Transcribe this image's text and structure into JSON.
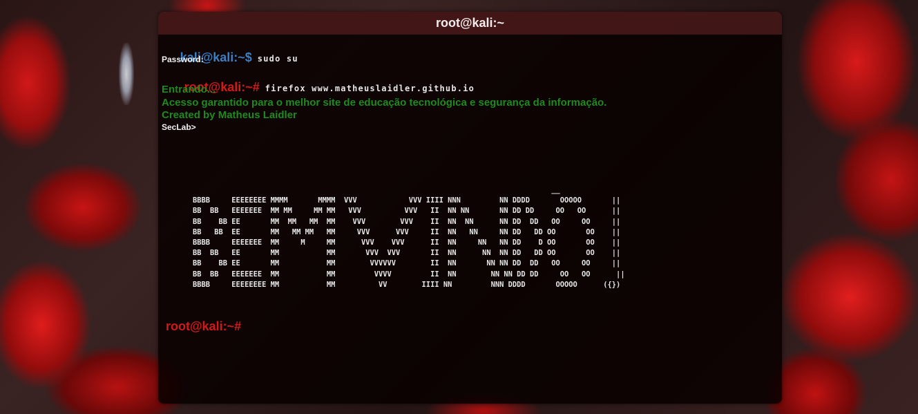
{
  "colors": {
    "user_prompt": "#3b7fc4",
    "root_prompt": "#d11a1a",
    "message": "#1f8a1f",
    "text": "#e6e6e6"
  },
  "window": {
    "title": "root@kali:~"
  },
  "terminal": {
    "line1": {
      "prompt": "kali@kali:~$",
      "command": "sudo su"
    },
    "line2": {
      "text": "Password:"
    },
    "line3": {
      "prompt": "root@kali:~#",
      "command": "firefox www.matheuslaidler.github.io"
    },
    "messages": [
      "Entrando...",
      "Acesso garantido para o melhor site de educação tecnológica e segurança da informação.",
      "Created by Matheus Laidler"
    ],
    "shell_label": "SecLab>",
    "ascii_art": [
      "                                                                                   __",
      "BBBB     EEEEEEEE MMMM       MMMM  VVV            VVV IIII NNN         NN DDDD       OOOOO       ||",
      "BB  BB   EEEEEEE  MM MM     MM MM   VVV          VVV   II  NN NN       NN DD DD     OO   OO      ||",
      "BB    BB EE       MM  MM   MM  MM    VVV        VVV    II  NN  NN      NN DD  DD   OO     OO     ||",
      "BB   BB  EE       MM   MM MM   MM     VVV      VVV     II  NN   NN     NN DD   DD OO       OO    ||",
      "BBBB     EEEEEEE  MM     M     MM      VVV    VVV      II  NN     NN   NN DD    D OO       OO    ||",
      "BB  BB   EE       MM           MM       VVV  VVV       II  NN      NN  NN DD   DD OO       OO    ||",
      "BB    BB EE       MM           MM        VVVVVV        II  NN       NN NN DD  DD   OO     OO     ||",
      "BB  BB   EEEEEEE  MM           MM         VVVV         II  NN        NN NN DD DD     OO   OO      ||",
      "BBBB     EEEEEEEE MM           MM          VV        IIII NN         NNN DDDD       OOOOO      ({})"
    ],
    "final_prompt": "root@kali:~#"
  }
}
